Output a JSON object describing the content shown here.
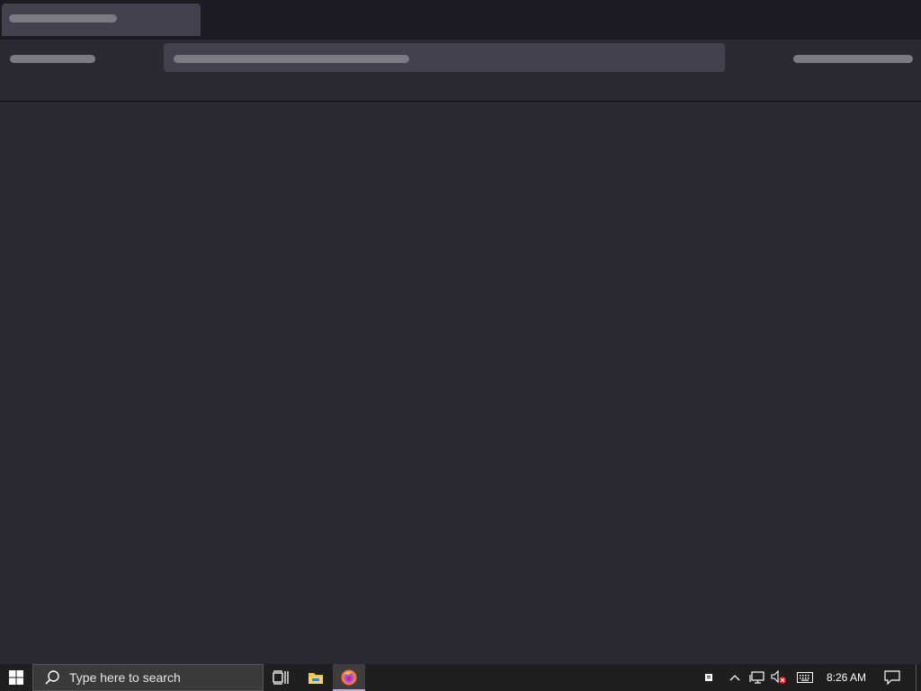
{
  "browser": {
    "theme_accent": "#c1a7e8"
  },
  "taskbar": {
    "search_placeholder": "Type here to search",
    "clock": "8:26 AM",
    "apps": [
      {
        "name": "Task View",
        "icon": "task-view-icon"
      },
      {
        "name": "File Explorer",
        "icon": "folder-icon"
      },
      {
        "name": "Firefox",
        "icon": "firefox-icon",
        "active": true
      }
    ],
    "tray_icons": [
      "notification-badge-icon",
      "chevron-up-icon",
      "network-icon",
      "volume-muted-icon",
      "keyboard-icon",
      "action-center-icon"
    ]
  }
}
